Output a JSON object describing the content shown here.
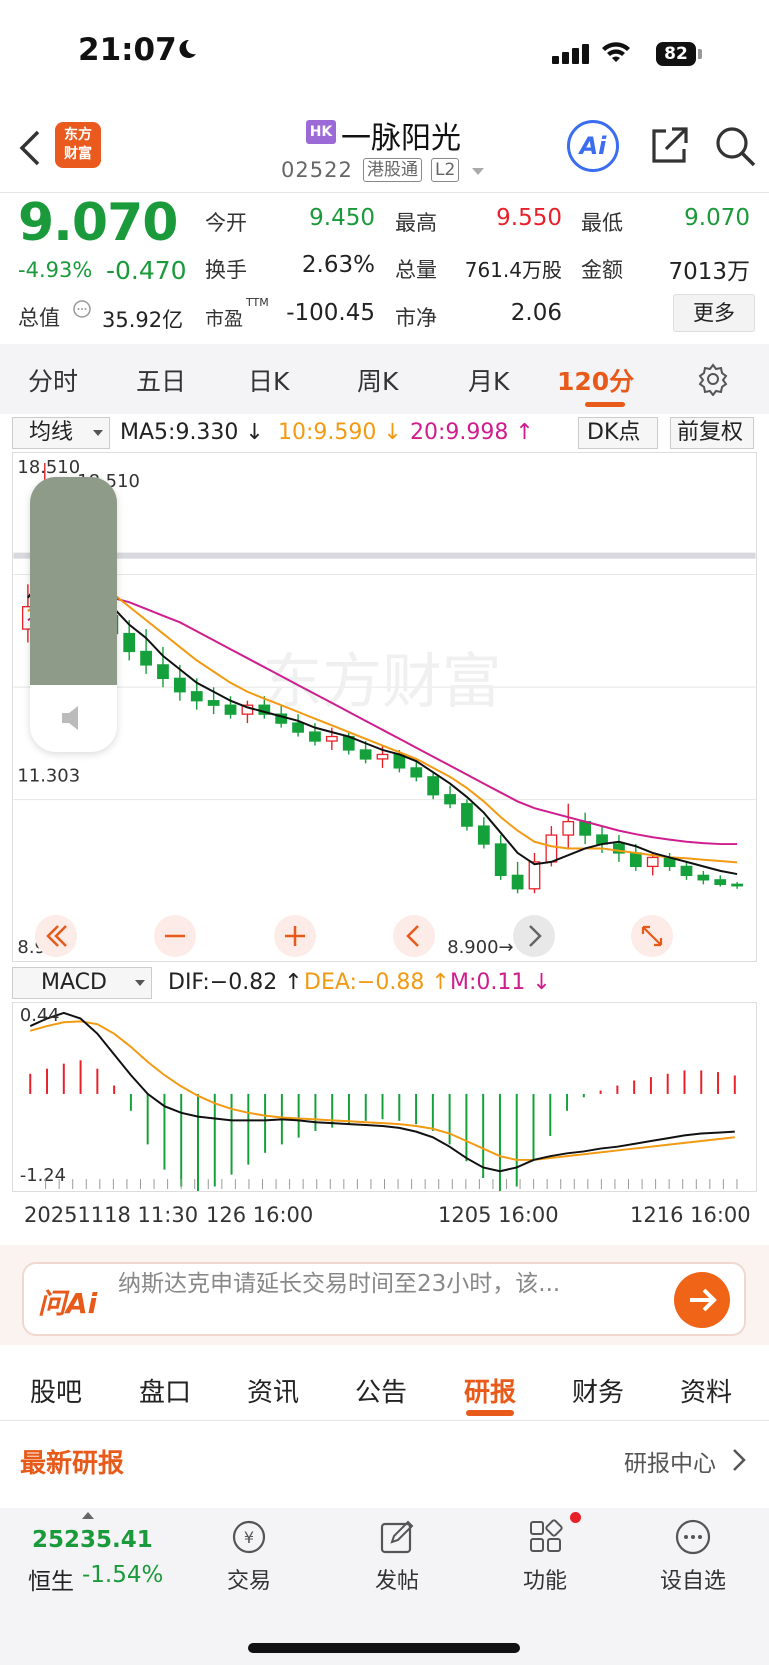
{
  "status_bar": {
    "time": "21:07",
    "battery": "82"
  },
  "header": {
    "logo_line1": "东方",
    "logo_line2": "财富",
    "market_badge": "HK",
    "stock_name": "一脉阳光",
    "stock_code": "02522",
    "tag_connect": "港股通",
    "tag_level": "L2",
    "ai_label": "Ai"
  },
  "quote": {
    "price": "9.070",
    "change_pct": "-4.93%",
    "change_abs": "-0.470",
    "open_label": "今开",
    "open_value": "9.450",
    "high_label": "最高",
    "high_value": "9.550",
    "low_label": "最低",
    "low_value": "9.070",
    "turnover_label": "换手",
    "turnover_value": "2.63%",
    "volume_label": "总量",
    "volume_value": "761.4万股",
    "amount_label": "金额",
    "amount_value": "7013万",
    "mktcap_label": "总值",
    "mktcap_value": "35.92亿",
    "pe_label": "市盈",
    "pe_sup": "TTM",
    "pe_value": "-100.45",
    "pb_label": "市净",
    "pb_value": "2.06",
    "more_label": "更多"
  },
  "periods": [
    "分时",
    "五日",
    "日K",
    "周K",
    "月K",
    "120分"
  ],
  "active_period": "120分",
  "ma_bar": {
    "selector": "均线",
    "ma5": "MA5:9.330 ↓",
    "ma10": "10:9.590 ↓",
    "ma20": "20:9.998 ↑",
    "dk_label": "DK点",
    "adjust_label": "前复权"
  },
  "chart_data": {
    "type": "candlestick",
    "y_labels": [
      "18.510",
      "11.303",
      "8.900"
    ],
    "max_label": "18.510",
    "min_label": "8.900→",
    "watermark": "东方财富",
    "candles": [
      [
        14.8,
        15.8,
        14.5,
        15.3
      ],
      [
        15.3,
        18.51,
        15.0,
        17.2
      ],
      [
        17.2,
        17.5,
        16.0,
        16.5
      ],
      [
        16.5,
        17.0,
        15.2,
        15.6
      ],
      [
        15.6,
        16.0,
        14.8,
        15.1
      ],
      [
        15.1,
        15.5,
        14.4,
        14.7
      ],
      [
        14.7,
        15.0,
        14.1,
        14.3
      ],
      [
        14.3,
        14.8,
        13.8,
        14.0
      ],
      [
        14.0,
        14.4,
        13.5,
        13.7
      ],
      [
        13.7,
        14.0,
        13.2,
        13.4
      ],
      [
        13.4,
        13.7,
        13.0,
        13.2
      ],
      [
        13.2,
        13.5,
        12.9,
        13.1
      ],
      [
        13.1,
        13.3,
        12.8,
        12.9
      ],
      [
        12.9,
        13.2,
        12.7,
        13.1
      ],
      [
        13.1,
        13.3,
        12.8,
        12.9
      ],
      [
        12.9,
        13.1,
        12.6,
        12.7
      ],
      [
        12.7,
        12.9,
        12.4,
        12.5
      ],
      [
        12.5,
        12.7,
        12.2,
        12.3
      ],
      [
        12.3,
        12.6,
        12.1,
        12.4
      ],
      [
        12.4,
        12.5,
        12.0,
        12.1
      ],
      [
        12.1,
        12.3,
        11.8,
        11.9
      ],
      [
        11.9,
        12.2,
        11.7,
        12.0
      ],
      [
        12.0,
        12.1,
        11.6,
        11.7
      ],
      [
        11.7,
        11.9,
        11.4,
        11.5
      ],
      [
        11.5,
        11.6,
        11.0,
        11.1
      ],
      [
        11.1,
        11.3,
        10.8,
        10.9
      ],
      [
        10.9,
        11.0,
        10.3,
        10.4
      ],
      [
        10.4,
        10.6,
        9.9,
        10.0
      ],
      [
        10.0,
        10.2,
        9.2,
        9.3
      ],
      [
        9.3,
        9.6,
        8.9,
        9.0
      ],
      [
        9.0,
        9.8,
        8.9,
        9.6
      ],
      [
        9.6,
        10.4,
        9.5,
        10.2
      ],
      [
        10.2,
        10.9,
        9.9,
        10.5
      ],
      [
        10.5,
        10.7,
        10.0,
        10.2
      ],
      [
        10.2,
        10.4,
        9.8,
        10.0
      ],
      [
        10.0,
        10.2,
        9.6,
        9.8
      ],
      [
        9.8,
        10.0,
        9.4,
        9.5
      ],
      [
        9.5,
        9.8,
        9.3,
        9.7
      ],
      [
        9.7,
        9.8,
        9.4,
        9.5
      ],
      [
        9.5,
        9.6,
        9.2,
        9.3
      ],
      [
        9.3,
        9.4,
        9.1,
        9.2
      ],
      [
        9.2,
        9.3,
        9.05,
        9.1
      ],
      [
        9.1,
        9.15,
        9.0,
        9.07
      ]
    ],
    "ma5": [
      15.5,
      16.0,
      16.2,
      16.1,
      15.8,
      15.3,
      14.9,
      14.6,
      14.2,
      13.9,
      13.6,
      13.4,
      13.2,
      13.05,
      12.95,
      12.85,
      12.75,
      12.6,
      12.5,
      12.4,
      12.25,
      12.1,
      12.0,
      11.85,
      11.6,
      11.35,
      11.05,
      10.7,
      10.25,
      9.8,
      9.55,
      9.6,
      9.75,
      9.9,
      10.0,
      10.05,
      9.95,
      9.8,
      9.7,
      9.6,
      9.5,
      9.4,
      9.33
    ],
    "ma10": [
      15.2,
      15.5,
      15.8,
      15.9,
      15.8,
      15.6,
      15.3,
      15.0,
      14.7,
      14.4,
      14.1,
      13.85,
      13.6,
      13.4,
      13.25,
      13.1,
      12.95,
      12.8,
      12.65,
      12.5,
      12.35,
      12.2,
      12.05,
      11.9,
      11.7,
      11.5,
      11.25,
      10.95,
      10.6,
      10.3,
      10.05,
      9.95,
      9.9,
      9.9,
      9.9,
      9.85,
      9.8,
      9.75,
      9.7,
      9.68,
      9.65,
      9.62,
      9.59
    ],
    "ma20": [
      15.0,
      15.2,
      15.4,
      15.5,
      15.55,
      15.5,
      15.4,
      15.25,
      15.1,
      14.95,
      14.75,
      14.55,
      14.35,
      14.15,
      13.95,
      13.75,
      13.55,
      13.35,
      13.15,
      12.95,
      12.75,
      12.55,
      12.35,
      12.15,
      11.95,
      11.75,
      11.55,
      11.35,
      11.15,
      10.95,
      10.8,
      10.7,
      10.6,
      10.5,
      10.4,
      10.3,
      10.22,
      10.15,
      10.1,
      10.05,
      10.02,
      10.0,
      9.998
    ],
    "x_labels": [
      "20251118 11:30",
      "126 16:00",
      "1205 16:00",
      "1216 16:00"
    ],
    "ylim": [
      8.9,
      18.51
    ]
  },
  "macd": {
    "selector": "MACD",
    "dif": "DIF:−0.82 ↑",
    "dea": "DEA:−0.88 ↑",
    "m": "M:0.11 ↓",
    "y_top": "0.44",
    "y_bottom": "-1.24",
    "hist": [
      0.12,
      0.15,
      0.18,
      0.2,
      0.15,
      0.05,
      -0.1,
      -0.3,
      -0.45,
      -0.55,
      -0.6,
      -0.55,
      -0.48,
      -0.42,
      -0.35,
      -0.3,
      -0.26,
      -0.22,
      -0.2,
      -0.18,
      -0.16,
      -0.15,
      -0.16,
      -0.18,
      -0.22,
      -0.3,
      -0.4,
      -0.5,
      -0.6,
      -0.55,
      -0.4,
      -0.25,
      -0.1,
      -0.02,
      0.02,
      0.05,
      0.08,
      0.1,
      0.12,
      0.14,
      0.14,
      0.13,
      0.11
    ],
    "dif_line": [
      0.3,
      0.38,
      0.44,
      0.38,
      0.22,
      0.0,
      -0.22,
      -0.42,
      -0.55,
      -0.62,
      -0.66,
      -0.68,
      -0.7,
      -0.7,
      -0.7,
      -0.69,
      -0.7,
      -0.72,
      -0.73,
      -0.74,
      -0.75,
      -0.76,
      -0.78,
      -0.82,
      -0.88,
      -0.98,
      -1.1,
      -1.2,
      -1.24,
      -1.2,
      -1.12,
      -1.08,
      -1.05,
      -1.03,
      -1.0,
      -0.98,
      -0.95,
      -0.92,
      -0.89,
      -0.86,
      -0.84,
      -0.83,
      -0.82
    ],
    "dea_line": [
      0.25,
      0.3,
      0.34,
      0.35,
      0.32,
      0.22,
      0.08,
      -0.08,
      -0.22,
      -0.34,
      -0.44,
      -0.52,
      -0.58,
      -0.62,
      -0.65,
      -0.67,
      -0.68,
      -0.69,
      -0.7,
      -0.71,
      -0.72,
      -0.73,
      -0.74,
      -0.76,
      -0.79,
      -0.84,
      -0.92,
      -1.0,
      -1.08,
      -1.12,
      -1.12,
      -1.1,
      -1.08,
      -1.06,
      -1.04,
      -1.02,
      -1.0,
      -0.98,
      -0.96,
      -0.94,
      -0.92,
      -0.9,
      -0.88
    ]
  },
  "ask_ai": {
    "brand": "问Ai",
    "text": "纳斯达克申请延长交易时间至23小时，该..."
  },
  "tabs": [
    "股吧",
    "盘口",
    "资讯",
    "公告",
    "研报",
    "财务",
    "资料"
  ],
  "active_tab": "研报",
  "section": {
    "title": "最新研报",
    "link": "研报中心"
  },
  "bottom_nav": {
    "index_value": "25235.41",
    "index_name": "恒生",
    "index_change": "-1.54%",
    "items": [
      "交易",
      "发帖",
      "功能",
      "设自选"
    ]
  }
}
